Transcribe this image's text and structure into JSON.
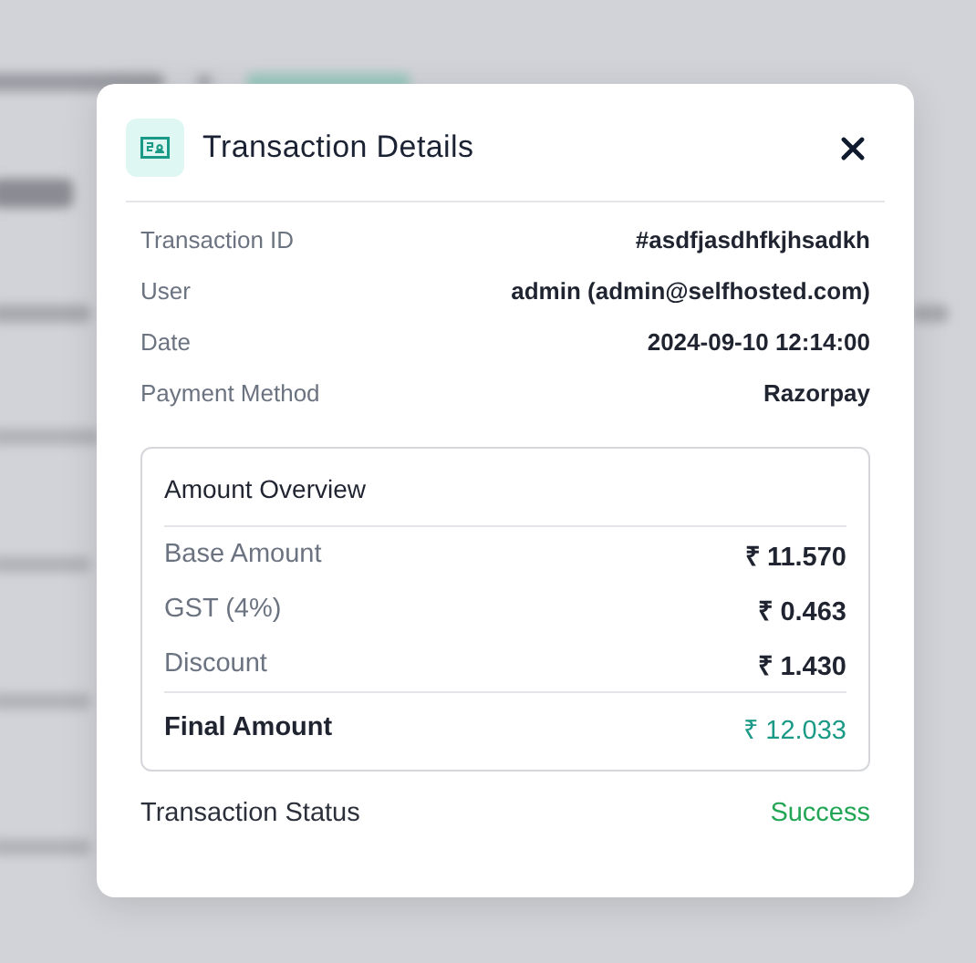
{
  "dialog": {
    "title": "Transaction Details",
    "details": [
      {
        "label": "Transaction ID",
        "value": "#asdfjasdhfkjhsadkh"
      },
      {
        "label": "User",
        "value": "admin (admin@selfhosted.com)"
      },
      {
        "label": "Date",
        "value": "2024-09-10 12:14:00"
      },
      {
        "label": "Payment Method",
        "value": "Razorpay"
      }
    ],
    "amount_overview": {
      "title": "Amount Overview",
      "rows": [
        {
          "label": "Base Amount",
          "value": "₹ 11.570",
          "kind": "line"
        },
        {
          "label": "GST (4%)",
          "value": "₹ 0.463",
          "kind": "line"
        },
        {
          "label": "Discount",
          "value": "₹ 1.430",
          "kind": "line"
        },
        {
          "label": "Final Amount",
          "value": "₹ 12.033",
          "kind": "total"
        }
      ]
    },
    "status": {
      "label": "Transaction Status",
      "value": "Success",
      "kind": "success"
    }
  }
}
